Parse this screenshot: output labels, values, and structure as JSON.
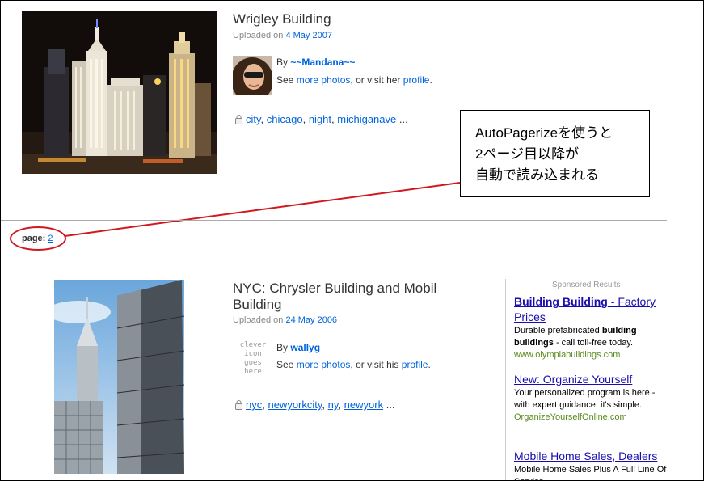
{
  "result1": {
    "title": "Wrigley Building",
    "uploaded_prefix": "Uploaded on",
    "uploaded_date": "4 May 2007",
    "by_prefix": "By",
    "user": "~~Mandana~~",
    "see_prefix": "See",
    "more_photos": "more photos",
    "visit_text": ", or visit her",
    "profile": "profile",
    "profile_suffix": ".",
    "tags": [
      "city",
      "chicago",
      "night",
      "michiganave"
    ],
    "tags_suffix": "..."
  },
  "callout": {
    "lines": [
      "AutoPagerizeを使うと",
      "2ページ目以降が",
      "自動で読み込まれる"
    ]
  },
  "pager": {
    "label": "page:",
    "page": "2"
  },
  "result2": {
    "title_line1": "NYC: Chrysler Building and Mobil",
    "title_line2": "Building",
    "uploaded_prefix": "Uploaded on",
    "uploaded_date": "24 May 2006",
    "clever_lines": [
      "clever",
      "icon",
      "goes",
      "here"
    ],
    "by_prefix": "By",
    "user": "wallyg",
    "see_prefix": "See",
    "more_photos": "more photos",
    "visit_text": ", or visit his",
    "profile": "profile",
    "profile_suffix": ".",
    "tags": [
      "nyc",
      "newyorkcity",
      "ny",
      "newyork"
    ],
    "tags_suffix": "..."
  },
  "sponsored": {
    "title": "Sponsored Results",
    "ads": [
      {
        "head_bold": "Building Building",
        "head_rest": " - Factory Prices",
        "desc_parts": [
          "Durable prefabricated ",
          "building buildings",
          " - call toll-free today."
        ],
        "url": "www.olympiabuildings.com"
      },
      {
        "head": "New: Organize Yourself",
        "desc": "Your personalized program is here - with expert guidance, it's simple.",
        "url": "OrganizeYourselfOnline.com"
      },
      {
        "head": "Mobile Home Sales, Dealers",
        "desc": "Mobile Home Sales Plus A Full Line Of Service"
      }
    ]
  },
  "colors": {
    "link": "#0063dc",
    "ad_link": "#1a0dab",
    "ad_url": "#5a8a1e",
    "annotation_red": "#d0181e"
  }
}
